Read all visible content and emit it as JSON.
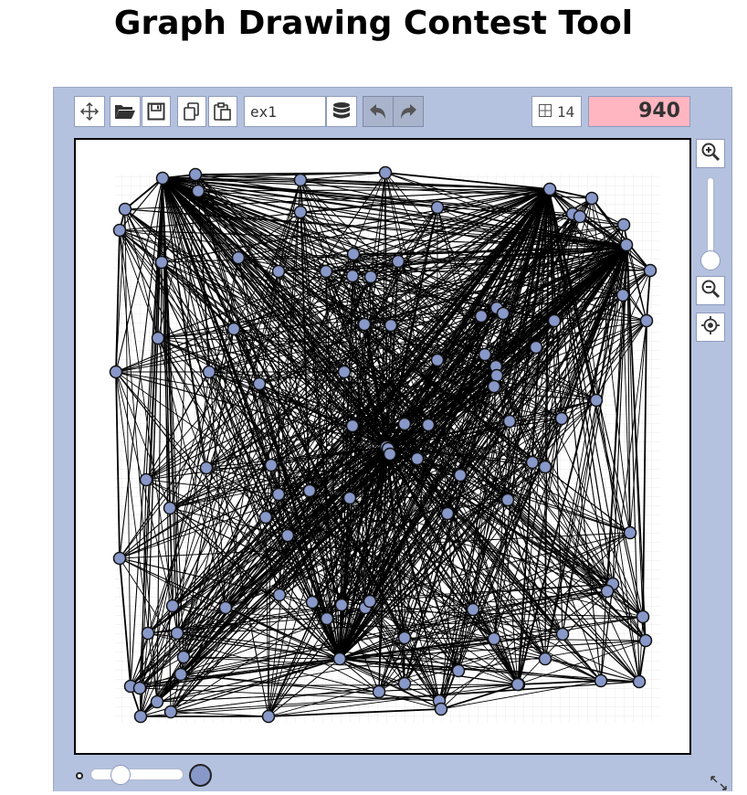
{
  "page": {
    "title": "Graph Drawing Contest Tool"
  },
  "toolbar": {
    "graph_name": "ex1",
    "grid_size": "14",
    "score": "940",
    "icons": [
      "move-icon",
      "open-folder-icon",
      "save-icon",
      "copy-icon",
      "paste-icon",
      "database-icon",
      "undo-icon",
      "redo-icon",
      "grid-icon"
    ]
  },
  "zoom": {
    "icons": [
      "zoom-in-icon",
      "zoom-out-icon",
      "center-icon"
    ],
    "level": 0.1
  },
  "vertex_size": {
    "level": 0.3
  },
  "colors": {
    "vertex_fill": "#8898c8",
    "frame": "#b5c2df",
    "score_bg": "#ffb6c1",
    "edge": "#000000"
  }
}
